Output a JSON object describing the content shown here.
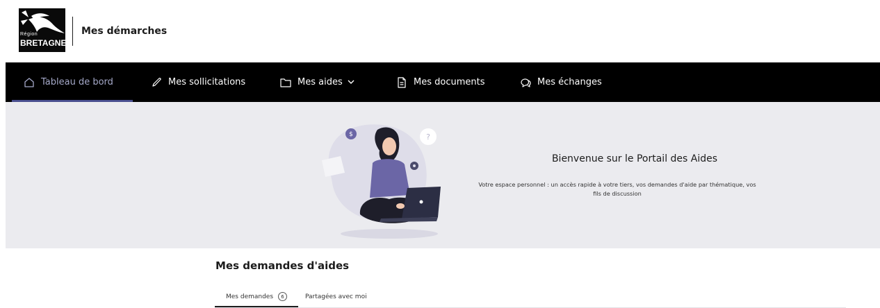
{
  "header": {
    "logo": {
      "line1": "Région",
      "line2": "BRETAGNE"
    },
    "title": "Mes démarches"
  },
  "nav": {
    "items": [
      {
        "label": "Tableau de bord",
        "icon": "home-icon",
        "active": true
      },
      {
        "label": "Mes sollicitations",
        "icon": "pen-icon"
      },
      {
        "label": "Mes aides",
        "icon": "folder-icon",
        "dropdown": true
      },
      {
        "label": "Mes documents",
        "icon": "document-icon"
      },
      {
        "label": "Mes échanges",
        "icon": "chat-icon"
      }
    ]
  },
  "hero": {
    "title": "Bienvenue sur le Portail des Aides",
    "text": "Votre espace personnel : un accès rapide à votre tiers, vos demandes d'aide par thématique, vos fils de discussion"
  },
  "main": {
    "section_title": "Mes demandes d'aides",
    "tabs": [
      {
        "label": "Mes demandes",
        "count": "6",
        "active": true
      },
      {
        "label": "Partagées avec moi"
      }
    ]
  },
  "colors": {
    "nav_bg": "#000000",
    "nav_active_text": "#a5a9c9",
    "nav_active_underline": "#4a5090",
    "hero_bg": "#ebebef",
    "illustration_accent": "#6b66a6"
  }
}
